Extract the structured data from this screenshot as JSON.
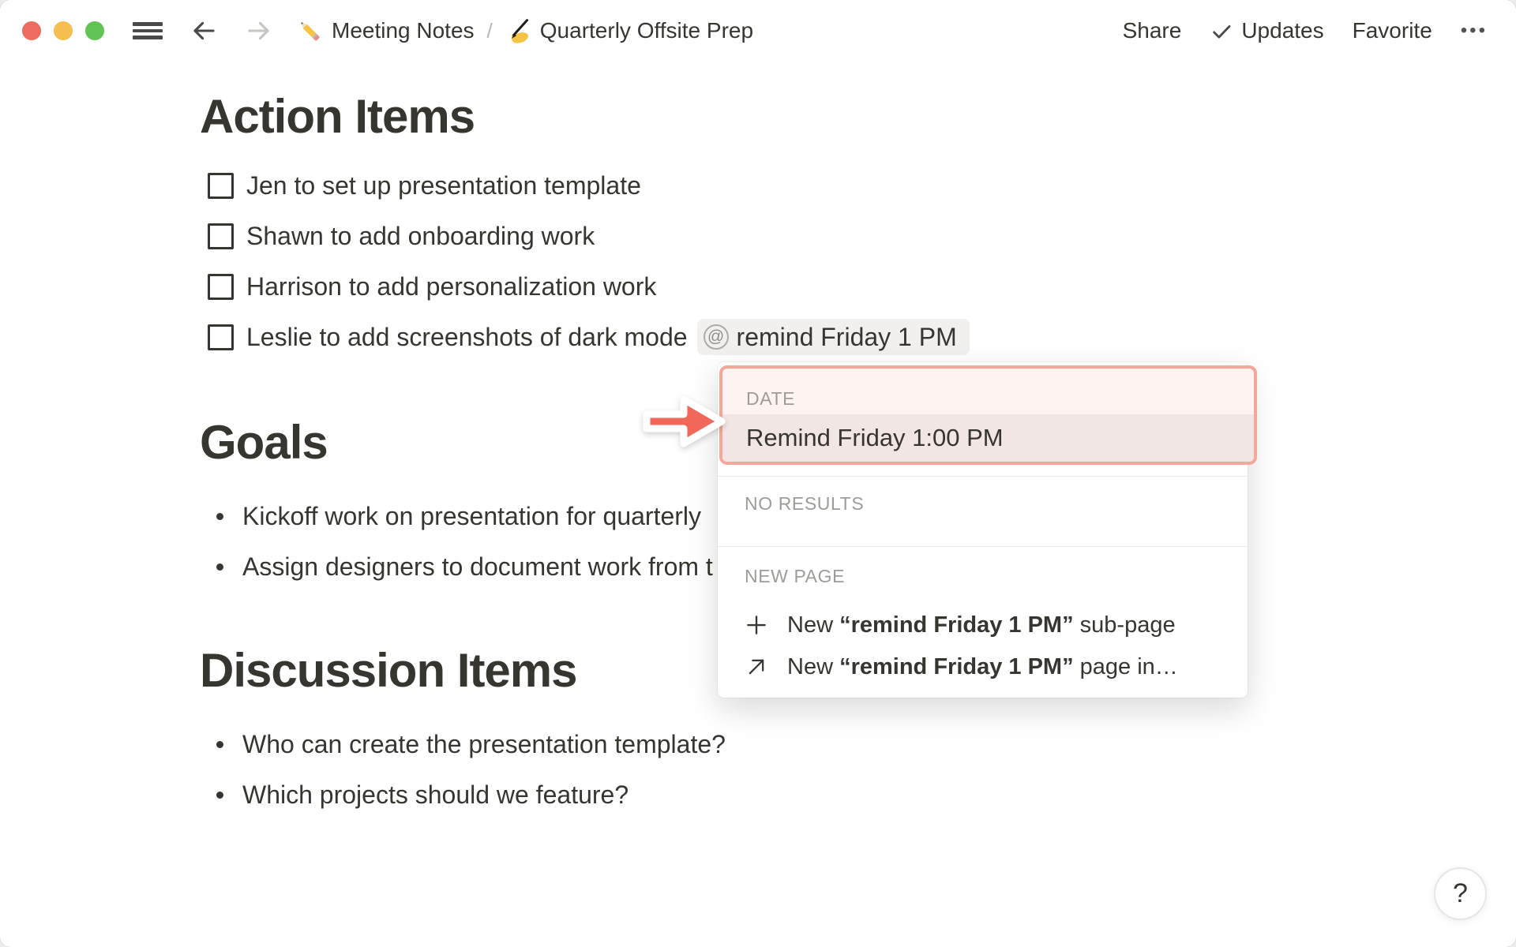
{
  "topbar": {
    "breadcrumb": {
      "page1": "Meeting Notes",
      "separator": "/",
      "page2": "Quarterly Offsite Prep"
    },
    "share": "Share",
    "updates": "Updates",
    "favorite": "Favorite",
    "more": "•••"
  },
  "doc": {
    "action_items": {
      "heading": "Action Items",
      "todos": [
        {
          "text": "Jen to set up presentation template",
          "checked": false
        },
        {
          "text": "Shawn to add onboarding work",
          "checked": false
        },
        {
          "text": "Harrison to add personalization work",
          "checked": false
        },
        {
          "text": "Leslie to add screenshots of dark mode",
          "checked": false,
          "mention": {
            "at": "@",
            "text": "remind Friday 1 PM"
          }
        }
      ]
    },
    "goals": {
      "heading": "Goals",
      "bullets": [
        "Kickoff work on presentation for quarterly",
        "Assign designers to document work from t"
      ]
    },
    "discussion": {
      "heading": "Discussion Items",
      "bullets": [
        "Who can create the presentation template?",
        "Which projects should we feature?"
      ]
    }
  },
  "popup": {
    "date_section": {
      "label": "DATE",
      "selected_item": "Remind Friday 1:00 PM"
    },
    "no_results_label": "NO RESULTS",
    "new_page": {
      "label": "NEW PAGE",
      "items": [
        {
          "prefix": "New ",
          "quoted": "“remind Friday 1 PM”",
          "suffix": " sub-page"
        },
        {
          "prefix": "New ",
          "quoted": "“remind Friday 1 PM”",
          "suffix": " page in…"
        }
      ]
    }
  },
  "help_label": "?",
  "colors": {
    "text": "#37352F",
    "muted_label": "#9E9C98",
    "annotation_red": "#F1675A",
    "highlight_border": "#F5A79B",
    "date_header_bg": "#FDF3F1",
    "selected_row_bg": "#F2E6E4",
    "mention_bg": "#F1F0EF",
    "traffic_red": "#ED6A5E",
    "traffic_yellow": "#F5BE4F",
    "traffic_green": "#61C454"
  }
}
